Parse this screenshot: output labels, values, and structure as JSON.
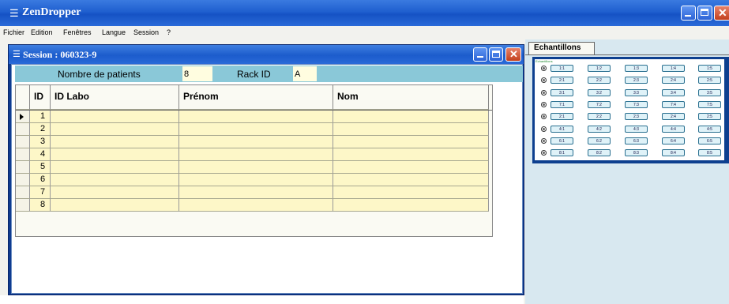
{
  "app": {
    "title": "ZenDropper",
    "menu": [
      "Fichier",
      "Edition",
      "Fenêtres",
      "Langue",
      "Session",
      "?"
    ]
  },
  "session": {
    "title": "Session : 060323-9",
    "nb_patients_label": "Nombre de patients",
    "nb_patients_value": "8",
    "rack_id_label": "Rack ID",
    "rack_id_value": "A",
    "columns": [
      "ID",
      "ID Labo",
      "Prénom",
      "Nom"
    ],
    "rows": [
      {
        "id": "1",
        "id_labo": "",
        "prenom": "",
        "nom": ""
      },
      {
        "id": "2",
        "id_labo": "",
        "prenom": "",
        "nom": ""
      },
      {
        "id": "3",
        "id_labo": "",
        "prenom": "",
        "nom": ""
      },
      {
        "id": "4",
        "id_labo": "",
        "prenom": "",
        "nom": ""
      },
      {
        "id": "5",
        "id_labo": "",
        "prenom": "",
        "nom": ""
      },
      {
        "id": "6",
        "id_labo": "",
        "prenom": "",
        "nom": ""
      },
      {
        "id": "7",
        "id_labo": "",
        "prenom": "",
        "nom": ""
      },
      {
        "id": "8",
        "id_labo": "",
        "prenom": "",
        "nom": ""
      }
    ],
    "selected_row": 0
  },
  "panel": {
    "tab_label": "Echantillons",
    "rack_caption": "Echantillons",
    "rack_rows": [
      [
        "1:1",
        "1:2",
        "1:3",
        "1:4",
        "1:5"
      ],
      [
        "2:1",
        "2:2",
        "2:3",
        "2:4",
        "2:5"
      ],
      [
        "3:1",
        "3:2",
        "3:3",
        "3:4",
        "3:5"
      ],
      [
        "7:1",
        "7:2",
        "7:3",
        "7:4",
        "7:5"
      ],
      [
        "2:1",
        "2:2",
        "2:3",
        "2:4",
        "2:5"
      ],
      [
        "4:1",
        "4:2",
        "4:3",
        "4:4",
        "4:5"
      ],
      [
        "6:1",
        "6:2",
        "6:3",
        "6:4",
        "6:5"
      ],
      [
        "8:1",
        "8:2",
        "8:3",
        "8:4",
        "8:5"
      ]
    ]
  },
  "icons": {
    "app": "app-window-icon",
    "minimize": "minimize-icon",
    "maximize": "maximize-icon",
    "close": "close-icon",
    "row_pointer": "row-pointer-icon"
  }
}
